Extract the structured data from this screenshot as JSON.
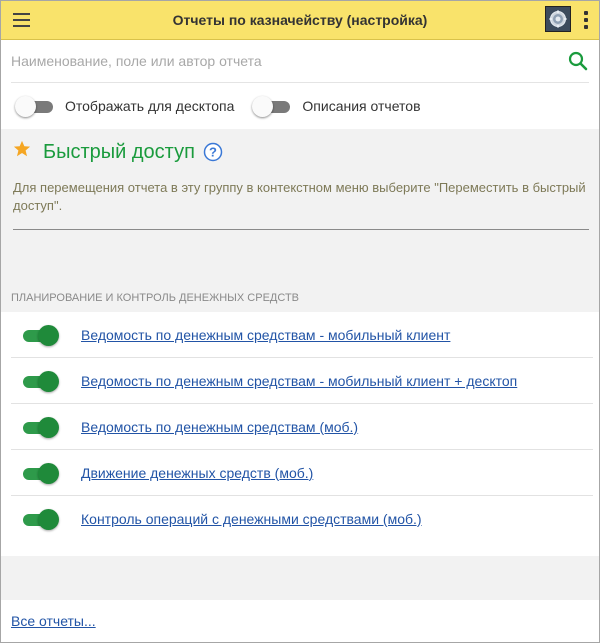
{
  "header": {
    "title": "Отчеты по казначейству (настройка)"
  },
  "search": {
    "placeholder": "Наименование, поле или автор отчета",
    "value": ""
  },
  "toggles": [
    {
      "label": "Отображать для десктопа",
      "on": false
    },
    {
      "label": "Описания отчетов",
      "on": false
    }
  ],
  "quick_access": {
    "title": "Быстрый доступ",
    "hint": "Для перемещения отчета в эту группу в контекстном меню выберите \"Переместить в быстрый доступ\"."
  },
  "section": {
    "title": "ПЛАНИРОВАНИЕ И КОНТРОЛЬ ДЕНЕЖНЫХ СРЕДСТВ",
    "reports": [
      {
        "label": "Ведомость по денежным средствам - мобильный клиент",
        "on": true
      },
      {
        "label": "Ведомость по денежным средствам - мобильный клиент + десктоп",
        "on": true
      },
      {
        "label": "Ведомость по денежным средствам (моб.)",
        "on": true
      },
      {
        "label": "Движение денежных средств (моб.)",
        "on": true
      },
      {
        "label": "Контроль операций с денежными средствами (моб.)",
        "on": true
      }
    ]
  },
  "footer": {
    "all_reports": "Все отчеты..."
  },
  "colors": {
    "header_bg": "#f9e36b",
    "accent_green": "#1a9b3d",
    "link_blue": "#2254a6",
    "star_orange": "#f5a623"
  },
  "icons": [
    "menu-icon",
    "settings-icon",
    "more-vert-icon",
    "search-icon",
    "star-icon",
    "help-icon"
  ]
}
